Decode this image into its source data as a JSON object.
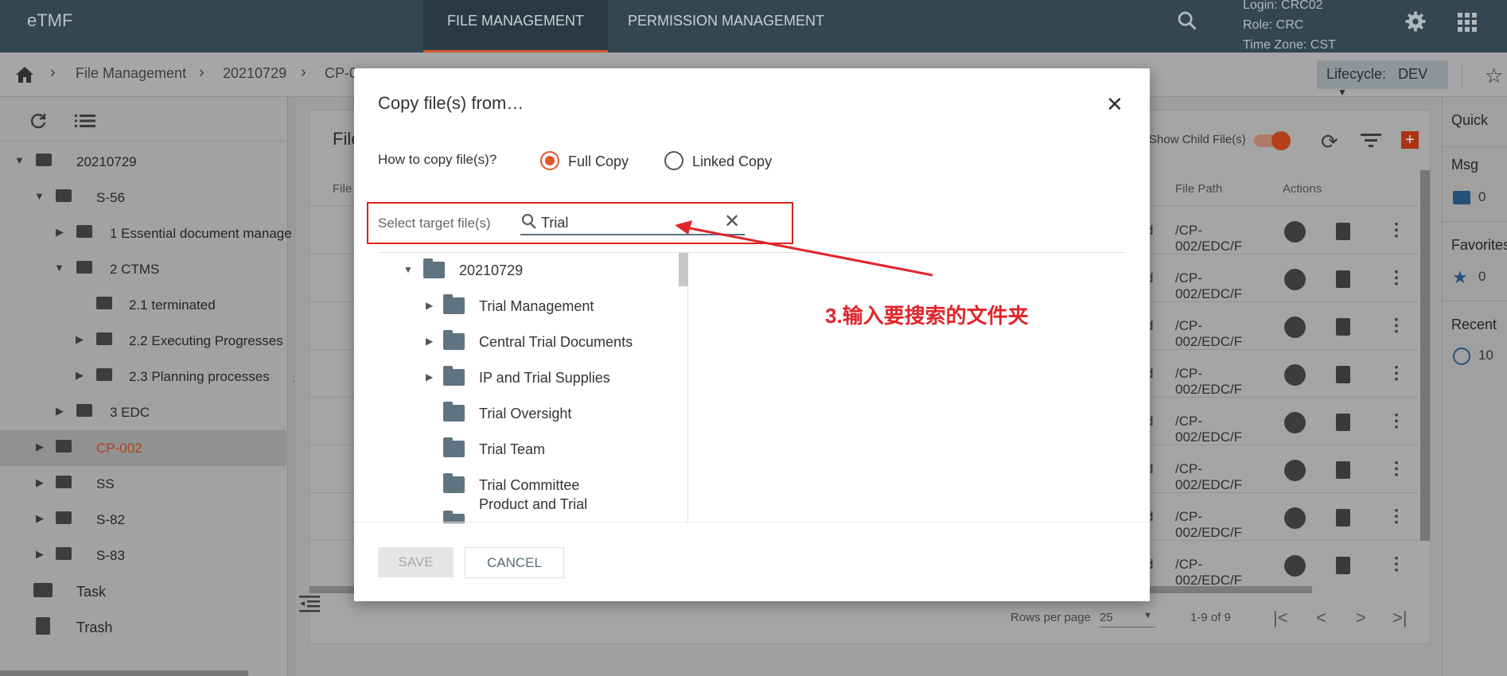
{
  "app": {
    "brand": "eTMF",
    "nav_tabs": [
      "FILE MANAGEMENT",
      "PERMISSION MANAGEMENT"
    ],
    "user": {
      "login": "Login: CRC02",
      "role": "Role: CRC",
      "timezone": "Time Zone: CST"
    },
    "icons": [
      "search-icon",
      "gear-icon",
      "apps-grid-icon"
    ]
  },
  "breadcrumb": {
    "items": [
      "File Management",
      "20210729",
      "CP-0"
    ],
    "lifecycle_label": "Lifecycle:",
    "lifecycle_value": "DEV"
  },
  "sidebar": {
    "tree": [
      {
        "label": "20210729",
        "level": 0,
        "expanded": true
      },
      {
        "label": "S-56",
        "level": 1,
        "expanded": true
      },
      {
        "label": "1  Essential document manage",
        "level": 2,
        "expanded": false
      },
      {
        "label": "2  CTMS",
        "level": 2,
        "expanded": true
      },
      {
        "label": "2.1  terminated",
        "level": 3,
        "expanded": null
      },
      {
        "label": "2.2  Executing Progresses",
        "level": 3,
        "expanded": false
      },
      {
        "label": "2.3  Planning processes",
        "level": 3,
        "expanded": false
      },
      {
        "label": "3  EDC",
        "level": 2,
        "expanded": false
      },
      {
        "label": "CP-002",
        "level": 1,
        "expanded": false,
        "selected": true
      },
      {
        "label": "SS",
        "level": 1,
        "expanded": false
      },
      {
        "label": "S-82",
        "level": 1,
        "expanded": false
      },
      {
        "label": "S-83",
        "level": 1,
        "expanded": false
      }
    ],
    "footer": [
      {
        "label": "Task",
        "icon": "briefcase-icon"
      },
      {
        "label": "Trash",
        "icon": "trash-icon"
      }
    ]
  },
  "main": {
    "title_partial": "File",
    "show_child_label": "Show Child File(s)",
    "columns": {
      "file": "File",
      "file_path": "File Path",
      "actions": "Actions"
    },
    "rows": [
      {
        "suffix": "d",
        "path": "/CP-002/EDC/F"
      },
      {
        "suffix": "d",
        "path": "/CP-002/EDC/F"
      },
      {
        "suffix": "d",
        "path": "/CP-002/EDC/F"
      },
      {
        "suffix": "d",
        "path": "/CP-002/EDC/F"
      },
      {
        "suffix": "d",
        "path": "/CP-002/EDC/F"
      },
      {
        "suffix": "d",
        "path": "/CP-002/EDC/F"
      },
      {
        "suffix": "d",
        "path": "/CP-002/EDC/F"
      },
      {
        "suffix": "d",
        "path": "/CP-002/EDC/F"
      }
    ],
    "pager": {
      "rows_per_page_label": "Rows per page",
      "rows_per_page": "25",
      "range": "1-9 of 9"
    }
  },
  "right_panel": {
    "quick": "Quick",
    "msg_label": "Msg",
    "msg_count": "0",
    "favorites_label": "Favorites",
    "favorites_count": "0",
    "recent_label": "Recent",
    "recent_count": "10"
  },
  "modal": {
    "title": "Copy file(s) from…",
    "how_label": "How to copy file(s)?",
    "options": [
      "Full Copy",
      "Linked Copy"
    ],
    "selected_option": "Full Copy",
    "search_label": "Select target file(s)",
    "search_value": "Trial",
    "tree": [
      {
        "label": "20210729",
        "level": 0,
        "expanded": true
      },
      {
        "label": "Trial Management",
        "level": 1,
        "expanded": false
      },
      {
        "label": "Central Trial Documents",
        "level": 1,
        "expanded": false
      },
      {
        "label": "IP and Trial Supplies",
        "level": 1,
        "expanded": false
      },
      {
        "label": "Trial Oversight",
        "level": 1,
        "expanded": null
      },
      {
        "label": "Trial Team",
        "level": 1,
        "expanded": null
      },
      {
        "label": "Trial Committee",
        "level": 1,
        "expanded": null
      },
      {
        "label": "Product and Trial",
        "level": 1,
        "expanded": null
      }
    ],
    "save_label": "SAVE",
    "cancel_label": "CANCEL"
  },
  "annotation": {
    "text": "3.输入要搜索的文件夹",
    "color": "#e0252b"
  }
}
